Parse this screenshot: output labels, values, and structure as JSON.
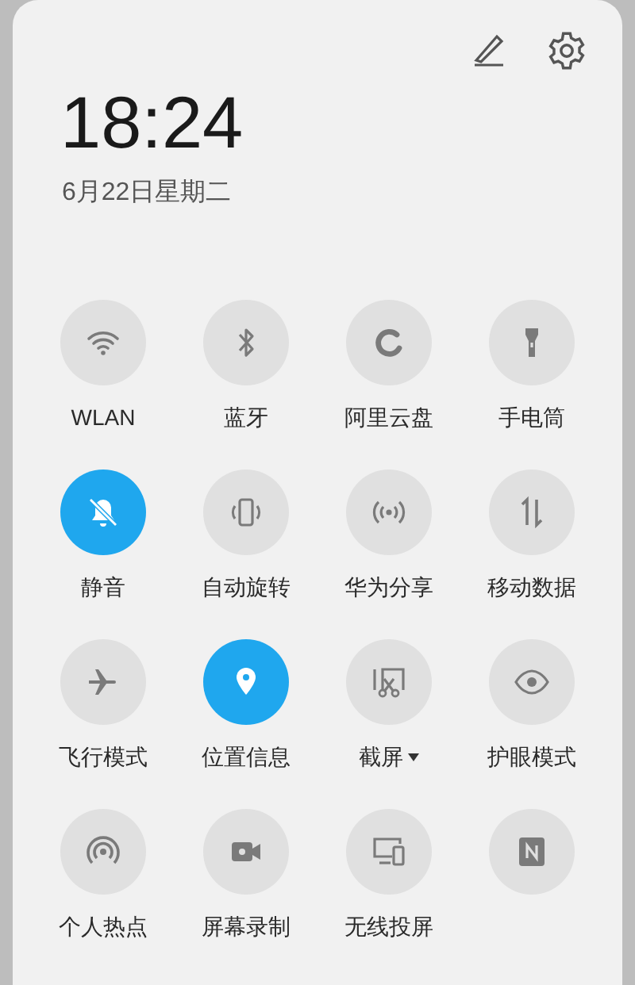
{
  "header": {
    "time": "18:24",
    "date": "6月22日星期二"
  },
  "tiles": [
    {
      "kind": "wifi",
      "label": "WLAN",
      "on": false
    },
    {
      "kind": "bluetooth",
      "label": "蓝牙",
      "on": false
    },
    {
      "kind": "cloud",
      "label": "阿里云盘",
      "on": false
    },
    {
      "kind": "flashlight",
      "label": "手电筒",
      "on": false
    },
    {
      "kind": "mute",
      "label": "静音",
      "on": true
    },
    {
      "kind": "rotate",
      "label": "自动旋转",
      "on": false
    },
    {
      "kind": "share",
      "label": "华为分享",
      "on": false
    },
    {
      "kind": "data",
      "label": "移动数据",
      "on": false
    },
    {
      "kind": "airplane",
      "label": "飞行模式",
      "on": false
    },
    {
      "kind": "location",
      "label": "位置信息",
      "on": true
    },
    {
      "kind": "screenshot",
      "label": "截屏",
      "on": false,
      "has_menu": true
    },
    {
      "kind": "eye",
      "label": "护眼模式",
      "on": false
    },
    {
      "kind": "hotspot",
      "label": "个人热点",
      "on": false
    },
    {
      "kind": "record",
      "label": "屏幕录制",
      "on": false
    },
    {
      "kind": "cast",
      "label": "无线投屏",
      "on": false
    },
    {
      "kind": "nfc",
      "on": false
    }
  ]
}
